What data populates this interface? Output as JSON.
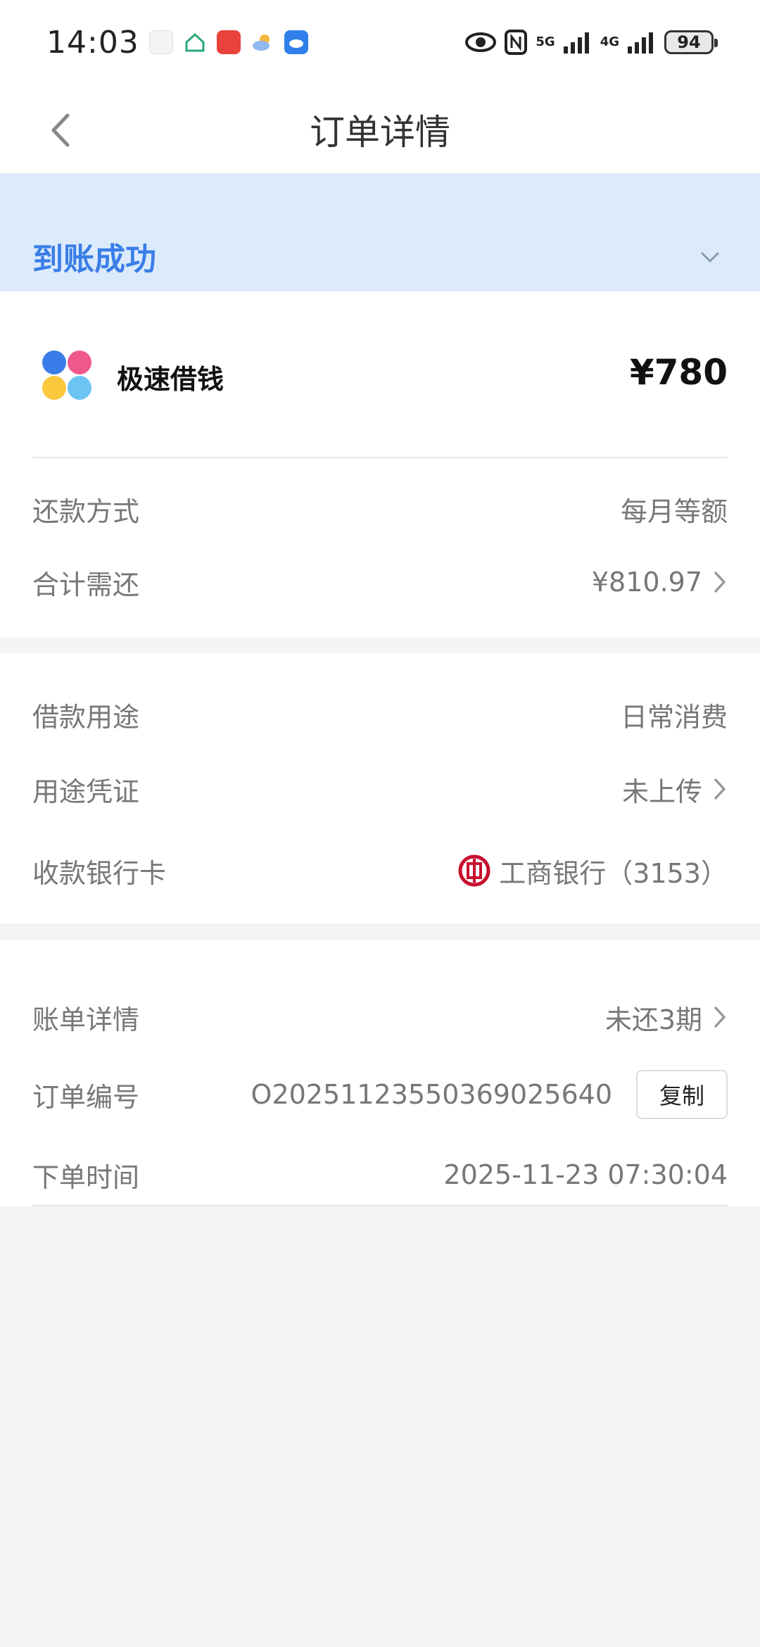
{
  "status_bar": {
    "time": "14:03",
    "net1": "5G",
    "net2": "4G",
    "battery": "94"
  },
  "nav": {
    "title": "订单详情"
  },
  "banner": {
    "status": "到账成功"
  },
  "product": {
    "name": "极速借钱",
    "amount": "¥780"
  },
  "repay": {
    "method_label": "还款方式",
    "method_value": "每月等额",
    "total_label": "合计需还",
    "total_value": "¥810.97"
  },
  "loan": {
    "purpose_label": "借款用途",
    "purpose_value": "日常消费",
    "voucher_label": "用途凭证",
    "voucher_value": "未上传",
    "card_label": "收款银行卡",
    "card_value": "工商银行（3153）"
  },
  "order": {
    "bill_label": "账单详情",
    "bill_value": "未还3期",
    "no_label": "订单编号",
    "no_value": "O2025112355036902564​0",
    "copy_label": "复制",
    "time_label": "下单时间",
    "time_value": "2025-11-23 07:30:04"
  },
  "colors": {
    "accent": "#3a7ee8",
    "banner_bg": "#dcebfc",
    "bank_red": "#c8102e"
  }
}
